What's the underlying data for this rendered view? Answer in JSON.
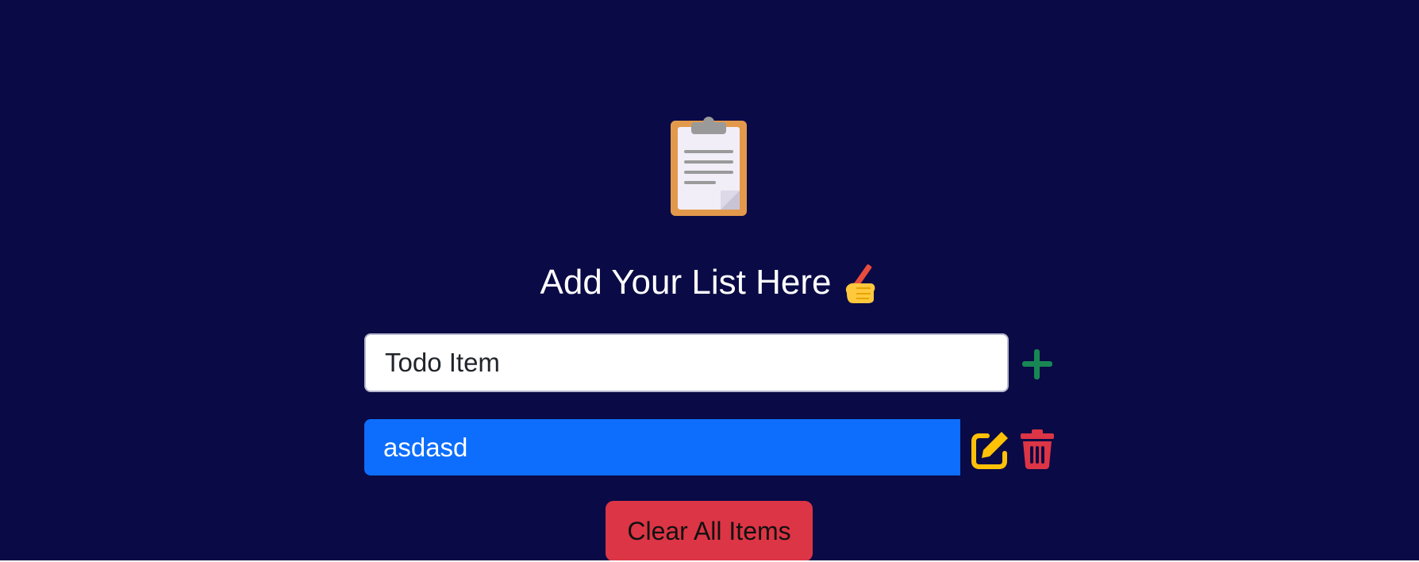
{
  "app": {
    "title": "Add Your List Here",
    "background_color": "#0a0a46"
  },
  "header": {
    "logo_icon": "clipboard-icon",
    "title_emoji_icon": "writing-hand-icon"
  },
  "input": {
    "placeholder": "Todo Item",
    "value": ""
  },
  "add_button": {
    "icon": "plus-icon",
    "color": "#198754"
  },
  "items": [
    {
      "text": "asdasd",
      "background_color": "#0d6efd",
      "edit_icon": "edit-icon",
      "edit_color": "#ffc107",
      "delete_icon": "trash-icon",
      "delete_color": "#dc3545"
    }
  ],
  "clear_button": {
    "label": "Clear All Items",
    "color": "#dc3545"
  }
}
